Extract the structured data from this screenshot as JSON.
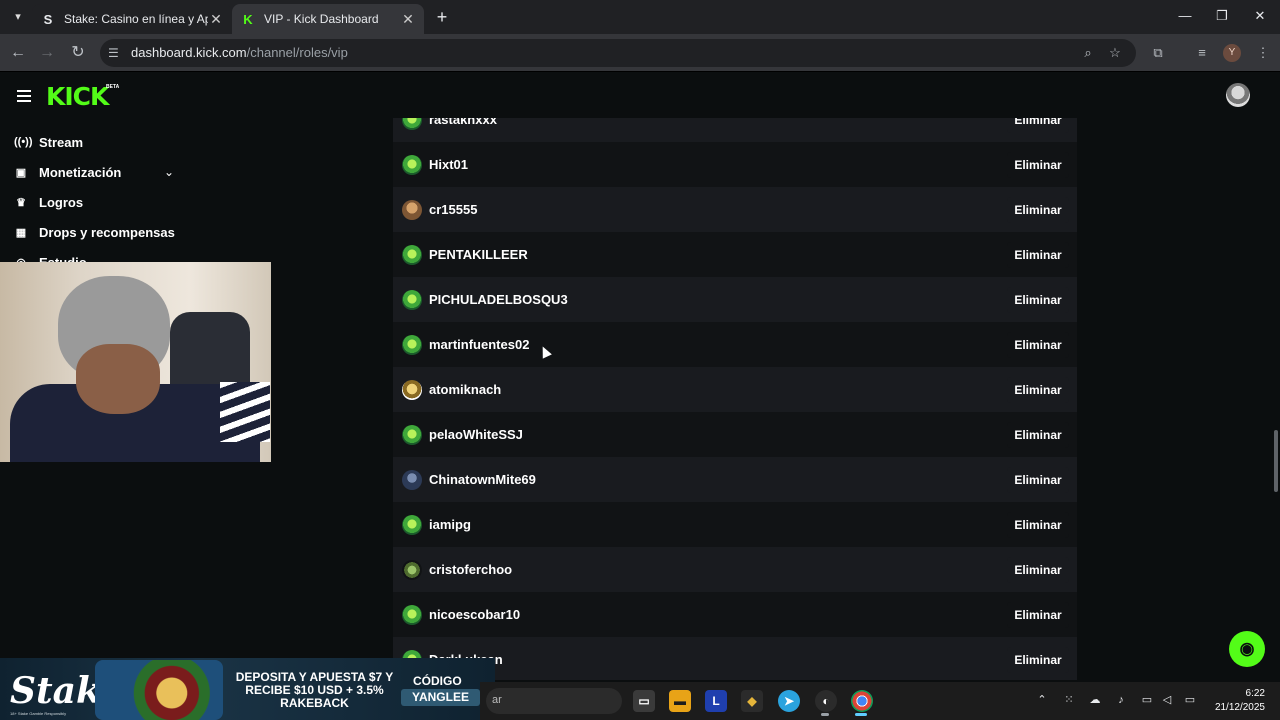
{
  "browser": {
    "tabs": [
      {
        "title": "Stake: Casino en línea y Ap",
        "favicon": "S"
      },
      {
        "title": "VIP - Kick Dashboard",
        "favicon": "K"
      }
    ],
    "url_host": "dashboard.kick.com",
    "url_path": "/channel/roles/vip",
    "profile_initial": "Y"
  },
  "kick": {
    "logo": "KICK",
    "beta": "BETA",
    "brand_color": "#53fc18"
  },
  "sidebar": {
    "items": [
      {
        "label": "Stream",
        "icon": "broadcast-icon"
      },
      {
        "label": "Monetización",
        "icon": "chart-icon",
        "expandable": true
      },
      {
        "label": "Logros",
        "icon": "trophy-icon"
      },
      {
        "label": "Drops y recompensas",
        "icon": "gift-icon"
      },
      {
        "label": "Estudio",
        "icon": "studio-icon",
        "expandable": true
      }
    ]
  },
  "vip_list": {
    "remove_label": "Eliminar",
    "users": [
      {
        "name": "rastakhxxx",
        "avatar": "green"
      },
      {
        "name": "Hixt01",
        "avatar": "green"
      },
      {
        "name": "cr15555",
        "avatar": "brown"
      },
      {
        "name": "PENTAKILLEER",
        "avatar": "green"
      },
      {
        "name": "PICHULADELBOSQU3",
        "avatar": "green"
      },
      {
        "name": "martinfuentes02",
        "avatar": "green"
      },
      {
        "name": "atomiknach",
        "avatar": "gold"
      },
      {
        "name": "pelaoWhiteSSJ",
        "avatar": "green"
      },
      {
        "name": "ChinatownMite69",
        "avatar": "blue"
      },
      {
        "name": "iamipg",
        "avatar": "green"
      },
      {
        "name": "cristoferchoo",
        "avatar": "plant"
      },
      {
        "name": "nicoescobar10",
        "avatar": "green"
      },
      {
        "name": "Darkl ukean",
        "avatar": "green"
      }
    ]
  },
  "ad": {
    "brand": "Stake",
    "tagline": "18+ Stake Gamble Responsibly",
    "text": "DEPOSITA Y APUESTA $7 Y RECIBE $10 USD + 3.5% RAKEBACK",
    "code_label": "CÓDIGO",
    "code": "YANGLEE"
  },
  "taskbar": {
    "search_placeholder": "ar",
    "time": "6:22",
    "date": "21/12/2025"
  }
}
